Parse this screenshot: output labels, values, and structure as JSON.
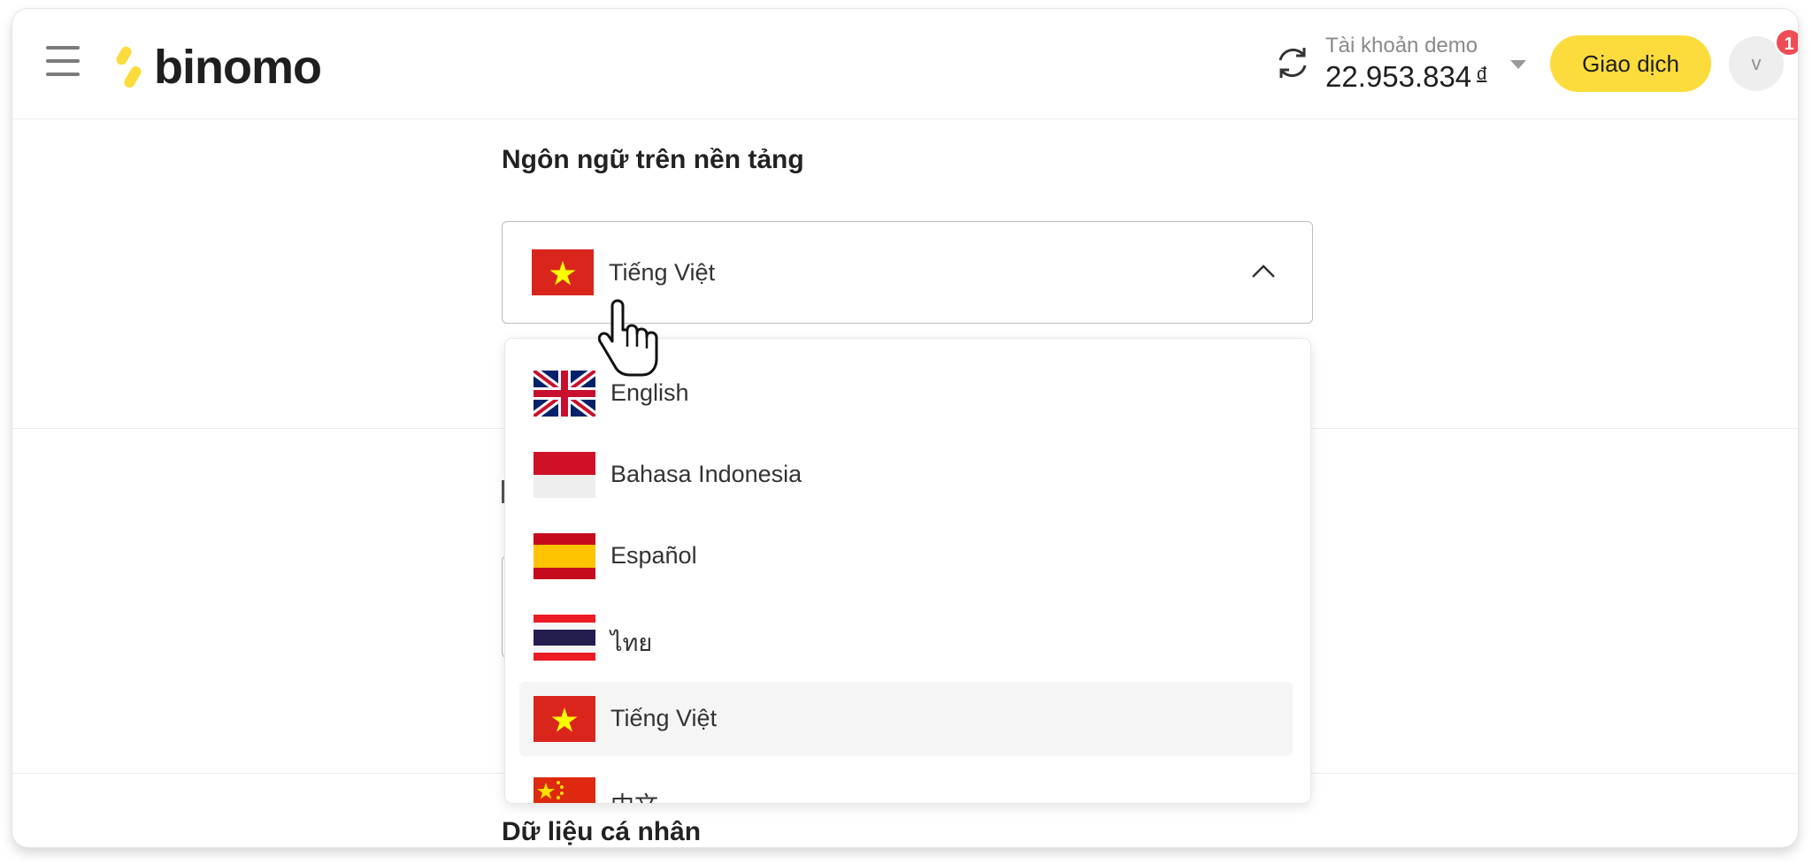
{
  "header": {
    "logo_text": "binomo",
    "account_label": "Tài khoản demo",
    "account_balance": "22.953.834",
    "currency_symbol": "đ",
    "trade_button": "Giao dịch",
    "avatar_initial": "v",
    "notification_count": "1"
  },
  "language_section": {
    "title": "Ngôn ngữ trên nền tảng",
    "selected_language": "Tiếng Việt"
  },
  "dropdown": {
    "options": [
      {
        "label": "English",
        "flag": "uk-flag-icon"
      },
      {
        "label": "Bahasa Indonesia",
        "flag": "indonesia-flag-icon"
      },
      {
        "label": "Español",
        "flag": "spain-flag-icon"
      },
      {
        "label": "ไทย",
        "flag": "thailand-flag-icon"
      },
      {
        "label": "Tiếng Việt",
        "flag": "vietnam-flag-icon",
        "selected": true
      },
      {
        "label": "中文",
        "flag": "china-flag-icon"
      }
    ]
  },
  "personal_section": {
    "title": "Dữ liệu cá nhân"
  },
  "colors": {
    "accent_yellow": "#fcdc3d",
    "badge_red": "#ef4d54",
    "vietnam_red": "#da251d",
    "vietnam_star": "#ffff00"
  }
}
